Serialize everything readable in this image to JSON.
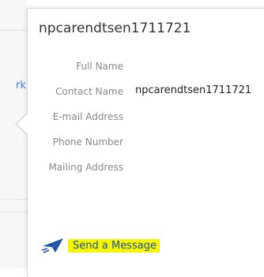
{
  "background": {
    "link_fragment": "rk"
  },
  "contact_card": {
    "title": "npcarendtsen1711721",
    "fields": [
      {
        "label": "Full Name",
        "value": ""
      },
      {
        "label": "Contact Name",
        "value": "npcarendtsen1711721"
      },
      {
        "label": "E-mail Address",
        "value": ""
      },
      {
        "label": "Phone Number",
        "value": ""
      },
      {
        "label": "Mailing Address",
        "value": ""
      }
    ],
    "send_action": {
      "label": "Send a Message",
      "icon": "paper-plane-icon",
      "highlight_color": "#f5f500",
      "text_color": "#1f4fa8"
    }
  }
}
